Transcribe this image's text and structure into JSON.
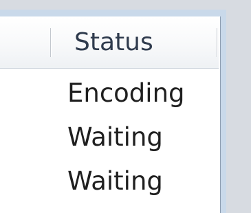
{
  "list": {
    "columns": [
      {
        "label": ""
      },
      {
        "label": "Status"
      }
    ],
    "rows": [
      {
        "status": "Encoding"
      },
      {
        "status": "Waiting"
      },
      {
        "status": "Waiting"
      }
    ]
  }
}
